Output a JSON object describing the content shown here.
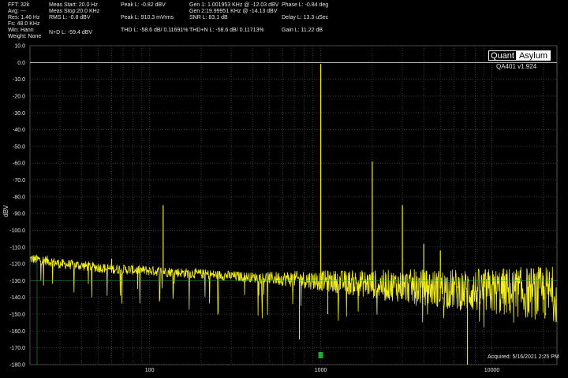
{
  "header": {
    "col1": [
      "FFT: 32k",
      "Avg: ---",
      "Res: 1.46 Hz",
      "Fs: 48.0 KHz",
      "Win: Hann",
      "Weight: None"
    ],
    "col2": [
      "Meas Start: 20.0 Hz",
      "Meas Stop:20.0 KHz",
      "RMS L: -0.8 dBV",
      "N+D L: -59.4 dBV"
    ],
    "peak_l": "Peak L: -0.82 dBV",
    "peak_v": "Peak L: 910.3 mVrms",
    "thd_l": "THD L: -58.6 dB/ 0.11691%",
    "gen1": "Gen 1: 1.001953 KHz @ -12.03  dBV",
    "gen2": "Gen 2:19.99951 KHz @ -14.13  dBV",
    "snr_l": "SNR L: 83.1 dB",
    "thdn_l": "THD+N L: -58.6 dB/ 0.11713%",
    "phase_l": "Phase L: -0.84 deg",
    "delay_l": "Delay L: 13.3 uSec",
    "gain_l": "Gain L: 11.22 dB"
  },
  "logo": {
    "left": "Quant",
    "right": "Asylum"
  },
  "version": "QA401 v1.924",
  "acquired": "Acquired: 5/16/2021  2:25 PM",
  "colors": {
    "trace": "#f2ee1c",
    "grid": "#3a3a3a",
    "zero_line": "#c8c8c8",
    "noise_floor_line": "#1f9a2a",
    "marker": "#1faa2a"
  },
  "chart_data": {
    "type": "line",
    "title": "",
    "xlabel": "",
    "ylabel": "dBV",
    "xscale": "log",
    "xlim": [
      20,
      24000
    ],
    "ylim": [
      -180,
      10
    ],
    "grid": true,
    "yticks": [
      10,
      0,
      -10,
      -20,
      -30,
      -40,
      -50,
      -60,
      -70,
      -80,
      -90,
      -100,
      -110,
      -120,
      -130,
      -140,
      -150,
      -160,
      -170,
      -180
    ],
    "ytick_labels": [
      "10.0",
      "0.0",
      "-10.0",
      "-20.0",
      "-30.0",
      "-40.0",
      "-50.0",
      "-60.0",
      "-70.0",
      "-80.0",
      "-90.0",
      "-100.0",
      "-110.0",
      "-120.0",
      "-130.0",
      "-140.0",
      "-150.0",
      "-160.0",
      "-170.0",
      "-180.0"
    ],
    "xticks": [
      100,
      1000,
      10000
    ],
    "xtick_labels": [
      "100",
      "1000",
      "10000"
    ],
    "noise_floor_dbv": -130,
    "series": [
      {
        "values_type": "spectrum",
        "baseline": [
          [
            20,
            -117
          ],
          [
            25,
            -118
          ],
          [
            30,
            -120
          ],
          [
            40,
            -121
          ],
          [
            60,
            -123
          ],
          [
            100,
            -124
          ],
          [
            200,
            -126
          ],
          [
            400,
            -128
          ],
          [
            700,
            -129
          ],
          [
            1000,
            -130
          ],
          [
            2000,
            -132
          ],
          [
            4000,
            -134
          ],
          [
            8000,
            -136
          ],
          [
            15000,
            -137
          ],
          [
            24000,
            -138
          ]
        ],
        "peaks": [
          {
            "x": 60,
            "y": -117
          },
          {
            "x": 120,
            "y": -85
          },
          {
            "x": 1000,
            "y": -0.82
          },
          {
            "x": 2000,
            "y": -59
          },
          {
            "x": 3000,
            "y": -85
          },
          {
            "x": 4000,
            "y": -108
          },
          {
            "x": 5000,
            "y": -112
          }
        ],
        "dips": [
          {
            "x": 750,
            "y": -165
          },
          {
            "x": 1100,
            "y": -150
          },
          {
            "x": 7200,
            "y": -180
          }
        ]
      }
    ]
  }
}
